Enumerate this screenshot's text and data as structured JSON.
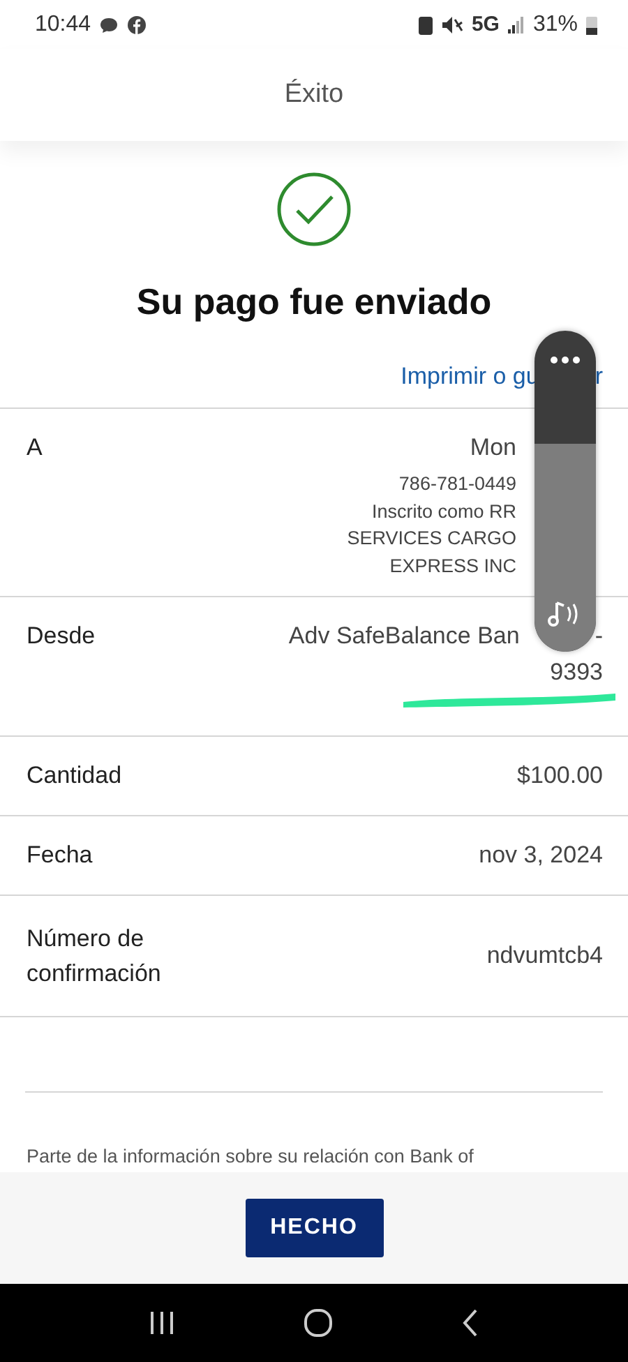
{
  "status_bar": {
    "time": "10:44",
    "network": "5G",
    "battery": "31%"
  },
  "header": {
    "title": "Éxito"
  },
  "heading": "Su pago fue enviado",
  "print_link": {
    "before": "Imprimir o gu",
    "after": "r"
  },
  "rows": [
    {
      "kind": "recipient",
      "label": "A",
      "name": "Mon",
      "phone": "786-781-0449",
      "enrolled": "Inscrito como RR",
      "company": [
        "SERVICES CARGO",
        "EXPRESS INC"
      ]
    },
    {
      "kind": "account",
      "label": "Desde",
      "value_before": "Adv SafeBalance Ban",
      "value_after": "-",
      "value_line2": "9393"
    },
    {
      "kind": "plain",
      "label": "Cantidad",
      "value": "$100.00"
    },
    {
      "kind": "plain",
      "label": "Fecha",
      "value": "nov 3, 2024"
    },
    {
      "kind": "plain",
      "label": "Número de confirmación",
      "value": "ndvumtcb4"
    }
  ],
  "disclaimer": "Parte de la información sobre su relación con Bank of",
  "done_button": "HECHO",
  "volume_panel": {
    "level": 0.65
  }
}
